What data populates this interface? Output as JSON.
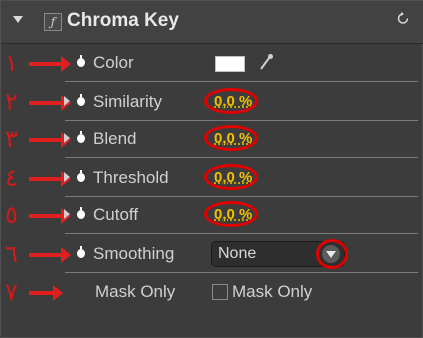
{
  "effect": {
    "title": "Chroma Key",
    "fx_glyph": "ƒ",
    "twirl_icon": "triangle-down-icon",
    "reset_icon": "reset-icon"
  },
  "annotations": {
    "color": "#e02020",
    "markers": [
      "١",
      "٢",
      "٣",
      "٤",
      "٥",
      "٦",
      "٧"
    ]
  },
  "properties": {
    "color": {
      "label": "Color",
      "swatch": "#ffffff"
    },
    "similarity": {
      "label": "Similarity",
      "value": "0,0 %"
    },
    "blend": {
      "label": "Blend",
      "value": "0,0 %"
    },
    "threshold": {
      "label": "Threshold",
      "value": "0,0 %"
    },
    "cutoff": {
      "label": "Cutoff",
      "value": "0,0 %"
    },
    "smoothing": {
      "label": "Smoothing",
      "selected": "None"
    },
    "mask_only": {
      "label": "Mask Only",
      "checkbox_label": "Mask Only",
      "checked": false
    }
  },
  "colors": {
    "panel_bg": "#3c3c3c",
    "value_yellow": "#f0c000",
    "highlight_red": "#e00000"
  }
}
